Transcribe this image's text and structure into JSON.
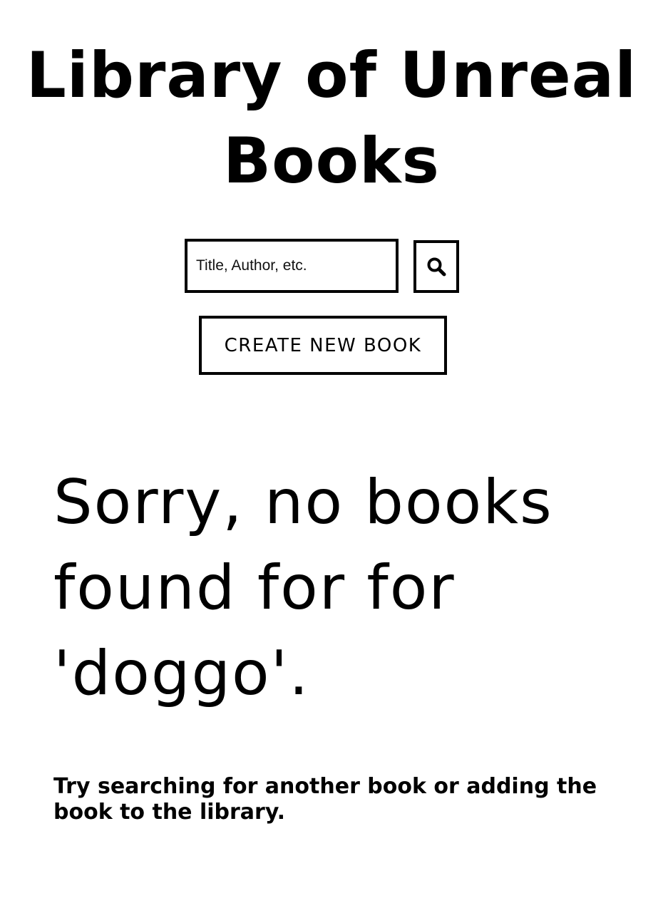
{
  "header": {
    "title": "Library of Unreal Books"
  },
  "search": {
    "placeholder": "Title, Author, etc.",
    "value": "",
    "button_icon": "search-icon"
  },
  "actions": {
    "create_label": "CREATE NEW BOOK"
  },
  "results": {
    "message": "Sorry, no books found for for 'doggo'.",
    "hint": "Try searching for another book or adding the book to the library."
  }
}
